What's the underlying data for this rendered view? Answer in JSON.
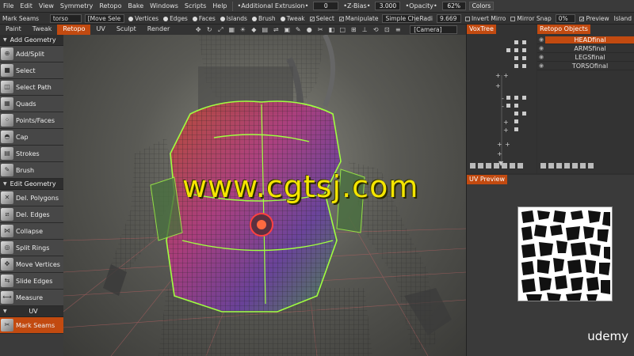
{
  "menubar": {
    "items": [
      "File",
      "Edit",
      "View",
      "Symmetry",
      "Retopo",
      "Bake",
      "Windows",
      "Scripts",
      "Help"
    ],
    "additional_extrusion_label": "•Additional Extrusion•",
    "additional_extrusion_value": "0",
    "zbias_label": "•Z-Bias•",
    "zbias_value": "3.000",
    "opacity_label": "•Opacity•",
    "opacity_value": "62%",
    "colors_button": "Colors"
  },
  "toolrow": {
    "tool_name": "Mark Seams",
    "object_dropdown": "torso",
    "mode_dropdown": "[Move Sele",
    "vertices": "Vertices",
    "edges": "Edges",
    "faces": "Faces",
    "islands": "Islands",
    "brush": "Brush",
    "tweak": "Tweak",
    "select": "Select",
    "manipulator": "Manipulate",
    "simple_che": "Simple Che",
    "radius_label": "Radi",
    "radius_value": "9.669",
    "invert_mirror": "Invert Mirro",
    "mirror_snap": "Mirror Snap",
    "snap_value": "0%",
    "preview": "Preview",
    "island": "Island"
  },
  "tabs": {
    "items": [
      "Paint",
      "Tweak",
      "Retopo",
      "UV",
      "Sculpt",
      "Render"
    ],
    "active": "Retopo",
    "camera": "[Camera]"
  },
  "leftpanel": {
    "sections": {
      "add_geometry": "Add Geometry",
      "edit_geometry": "Edit Geometry",
      "uv": "UV"
    },
    "add_tools": [
      "Add/Split",
      "Select",
      "Select Path",
      "Quads",
      "Points/Faces",
      "Cap",
      "Strokes",
      "Brush"
    ],
    "edit_tools": [
      "Del. Polygons",
      "Del. Edges",
      "Collapse",
      "Split Rings",
      "Move Vertices",
      "Slide Edges",
      "Measure"
    ],
    "uv_tools": [
      "Mark Seams"
    ]
  },
  "viewport": {
    "watermark": "www.cgtsj.com"
  },
  "voxtree": {
    "title": "VoxTree"
  },
  "retopo_objects": {
    "title": "Retopo Objects",
    "items": [
      "HEADfinal",
      "ARMSfinal",
      "LEGSfinal",
      "TORSOfinal"
    ],
    "selected": "HEADfinal"
  },
  "uv_preview": {
    "title": "UV Preview"
  },
  "branding": {
    "udemy": "udemy"
  },
  "colors": {
    "accent": "#c24a10",
    "watermark": "#f5e600"
  }
}
